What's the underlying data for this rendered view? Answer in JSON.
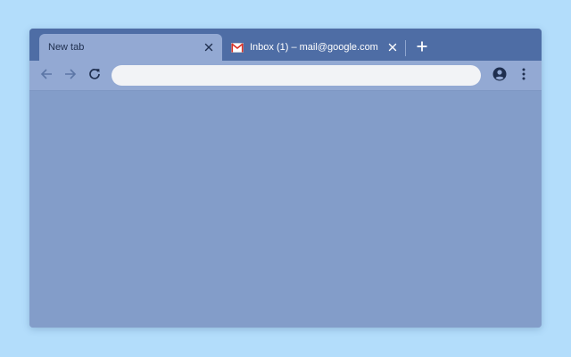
{
  "tabs": [
    {
      "title": "New tab",
      "active": true,
      "close_icon": "close-icon"
    },
    {
      "title": "Inbox (1) – mail@google.com",
      "active": false,
      "favicon": "gmail-icon",
      "close_icon": "close-icon"
    }
  ],
  "new_tab_icon": "plus-icon",
  "toolbar": {
    "back_icon": "arrow-left-icon",
    "forward_icon": "arrow-right-icon",
    "reload_icon": "reload-icon",
    "profile_icon": "account-circle-icon",
    "menu_icon": "more-vert-icon"
  },
  "omnibox": {
    "value": "",
    "placeholder": ""
  },
  "colors": {
    "background": "#b3ddfb",
    "tabstrip": "#4e6da5",
    "active_tab": "#93a9d3",
    "toolbar": "#93a9d3",
    "content": "#839dc9",
    "omnibox": "#f2f3f6",
    "icon": "#1f2f4f"
  }
}
